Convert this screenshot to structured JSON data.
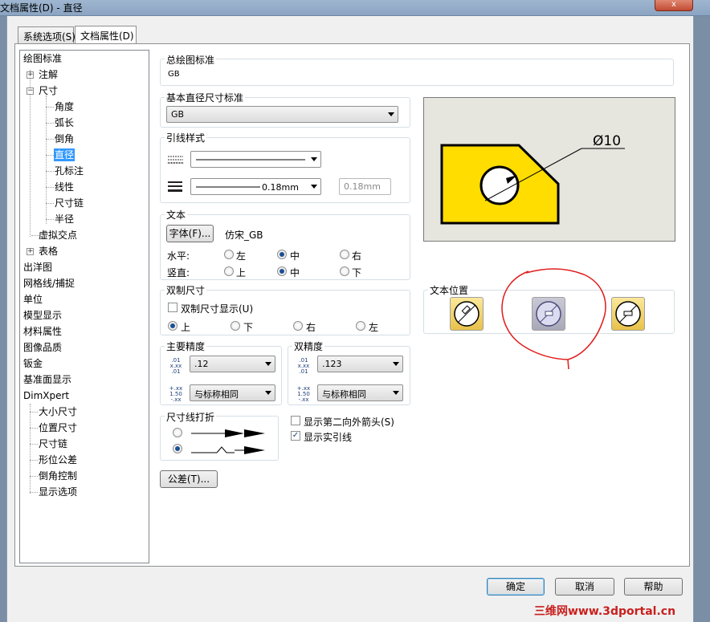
{
  "window": {
    "title": "文档属性(D) - 直径",
    "close_label": "x"
  },
  "tabs": [
    {
      "label": "系统选项(S)"
    },
    {
      "label": "文档属性(D)"
    }
  ],
  "tree": {
    "drafting_standard": "绘图标准",
    "annotations": "注解",
    "dimensions": "尺寸",
    "angle": "角度",
    "arc_length": "弧长",
    "chamfer": "倒角",
    "diameter": "直径",
    "hole_callout": "孔标注",
    "linear": "线性",
    "dimension_chain": "尺寸链",
    "radius": "半径",
    "virtual_sharps": "虚拟交点",
    "tables": "表格",
    "detailing": "出洋图",
    "grid_snap": "网格线/捕捉",
    "units": "单位",
    "model_display": "模型显示",
    "material_properties": "材料属性",
    "image_quality": "图像品质",
    "sheet_metal": "钣金",
    "plane_display": "基准面显示",
    "dimxpert": "DimXpert",
    "size_dimension": "大小尺寸",
    "location_dimension": "位置尺寸",
    "chain_dimension": "尺寸链",
    "geometric_tolerance": "形位公差",
    "chamfer_controls": "倒角控制",
    "display_options": "显示选项"
  },
  "overall_standard": {
    "label": "总绘图标准",
    "value": "GB"
  },
  "base_standard": {
    "label": "基本直径尺寸标准",
    "value": "GB"
  },
  "leader_style": {
    "label": "引线样式",
    "thickness_value": "0.18mm",
    "thickness_custom": "0.18mm"
  },
  "text": {
    "label": "文本",
    "font_button": "字体(F)...",
    "font_name": "仿宋_GB",
    "horizontal_label": "水平:",
    "vertical_label": "竖直:",
    "h_options": [
      "左",
      "中",
      "右"
    ],
    "v_options": [
      "上",
      "中",
      "下"
    ],
    "h_selected": "中",
    "v_selected": "中"
  },
  "dual": {
    "label": "双制尺寸",
    "checkbox_label": "双制尺寸显示(U)",
    "options": [
      "上",
      "下",
      "右",
      "左"
    ],
    "selected": "上"
  },
  "primary_precision": {
    "label": "主要精度",
    "value": ".12",
    "tolerance": "与标称相同",
    "icon1": "x.xx",
    "icon2": "1.50"
  },
  "dual_precision": {
    "label": "双精度",
    "value": ".123",
    "tolerance": "与标称相同",
    "icon1": "x.xx",
    "icon2": "1.50"
  },
  "break_lines": {
    "label": "尺寸线打折"
  },
  "options": {
    "second_outside_arrow": "显示第二向外箭头(S)",
    "show_leader": "显示实引线",
    "second_checked": false,
    "leader_checked": true
  },
  "tolerance_button": "公差(T)...",
  "preview": {
    "dim_label": "Ø10"
  },
  "text_position": {
    "label": "文本位置"
  },
  "footer": {
    "ok": "确定",
    "cancel": "取消",
    "help": "帮助"
  },
  "watermark": "三维网www.3dportal.cn",
  "colors": {
    "part_fill": "#ffdd00",
    "preview_bg": "#e6e5de",
    "selection": "#3399ff",
    "annotation": "#e11a1a"
  }
}
